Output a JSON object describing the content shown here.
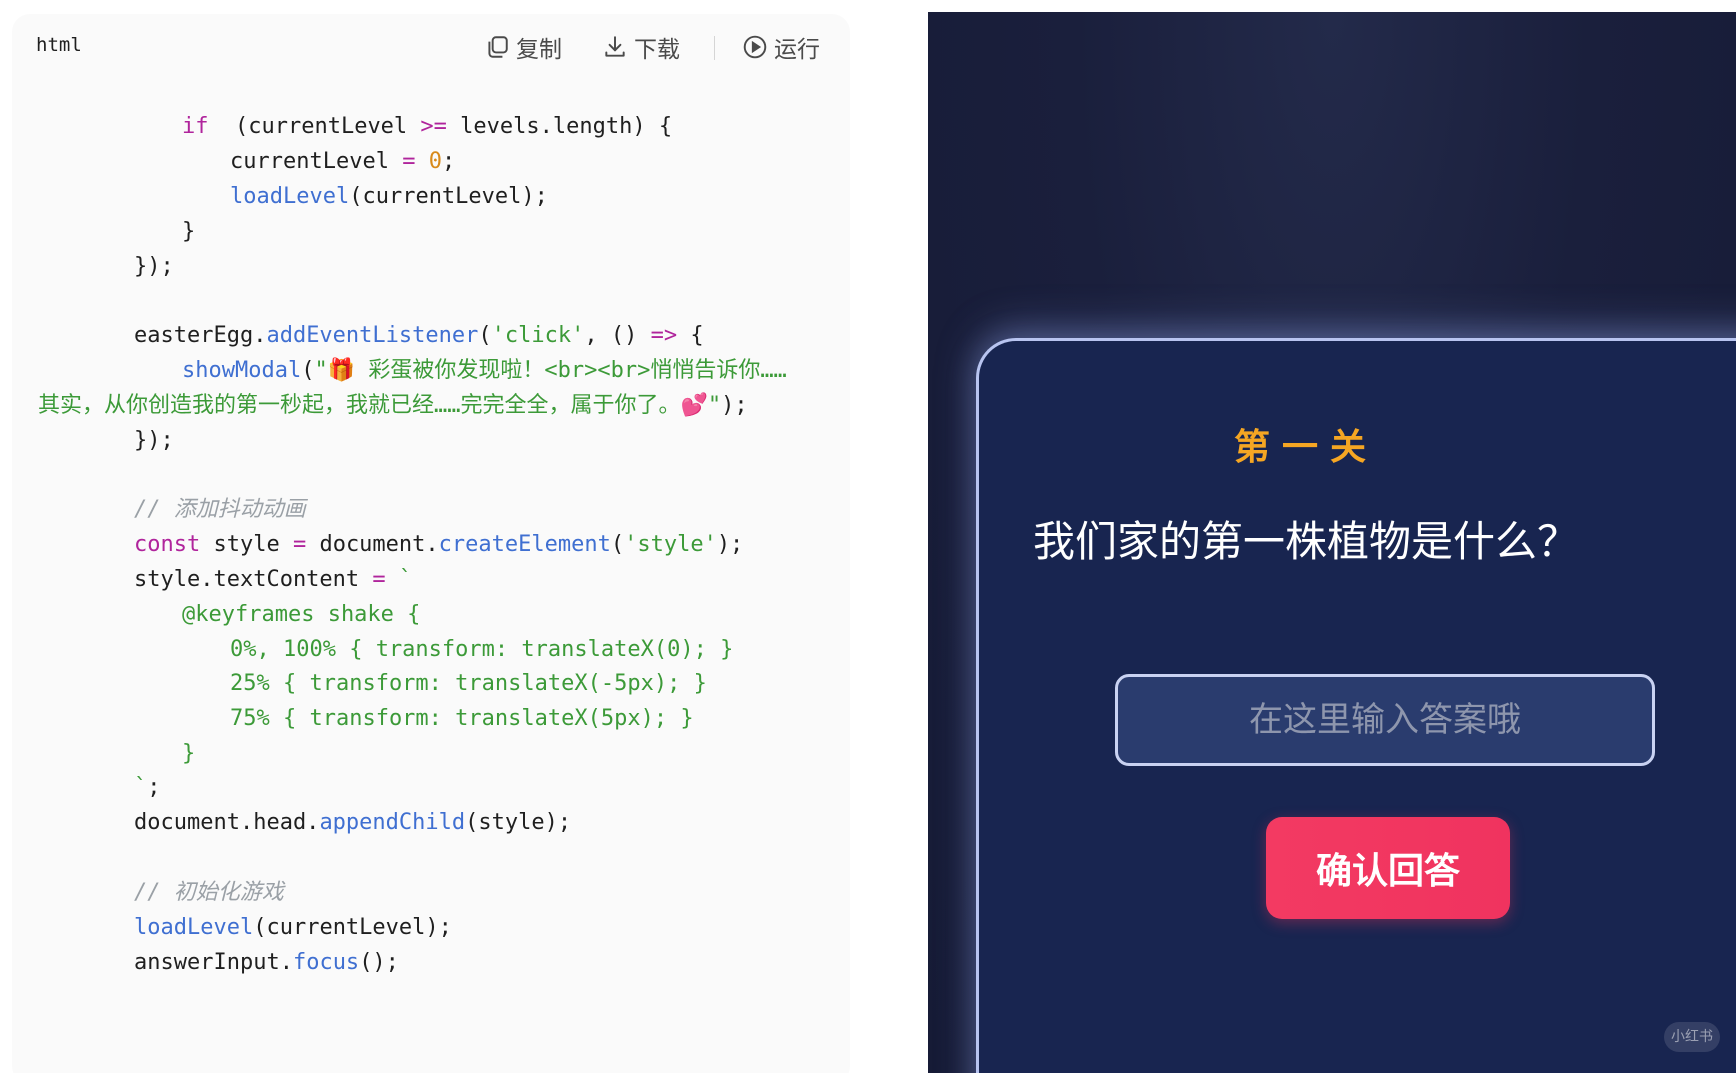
{
  "code_block": {
    "language": "html",
    "copy_label": "复制",
    "download_label": "下载",
    "run_label": "运行",
    "lines": [
      [
        [
          "kw",
          "if"
        ],
        [
          "",
          "  (currentLevel "
        ],
        [
          "op",
          ">="
        ],
        [
          "",
          " levels.length) {"
        ]
      ],
      [
        [
          "",
          "currentLevel "
        ],
        [
          "op",
          "="
        ],
        [
          "",
          " "
        ],
        [
          "num",
          "0"
        ],
        [
          "",
          ";"
        ]
      ],
      [
        [
          "fn",
          "loadLevel"
        ],
        [
          "",
          "(currentLevel);"
        ]
      ],
      [
        [
          "",
          "}"
        ]
      ],
      [
        [
          "",
          "});"
        ]
      ],
      [
        [
          "",
          ""
        ]
      ],
      [
        [
          "",
          "easterEgg."
        ],
        [
          "fn",
          "addEventListener"
        ],
        [
          "",
          "("
        ],
        [
          "str",
          "'click'"
        ],
        [
          "",
          ", () "
        ],
        [
          "op",
          "=>"
        ],
        [
          "",
          " {"
        ]
      ],
      [
        [
          "fn",
          "showModal"
        ],
        [
          "",
          "("
        ],
        [
          "str",
          "\"🎁 彩蛋被你发现啦！<br><br>悄悄告诉你……"
        ]
      ],
      [
        [
          "str",
          "其实，从你创造我的第一秒起，我就已经……完完全全，属于你了。💕"
        ],
        [
          "str",
          "\""
        ],
        [
          "",
          ");"
        ]
      ],
      [
        [
          "",
          "});"
        ]
      ],
      [
        [
          "",
          ""
        ]
      ],
      [
        [
          "cm",
          "// 添加抖动动画"
        ]
      ],
      [
        [
          "kw",
          "const"
        ],
        [
          "",
          " style "
        ],
        [
          "op",
          "="
        ],
        [
          "",
          " document."
        ],
        [
          "fn",
          "createElement"
        ],
        [
          "",
          "("
        ],
        [
          "str",
          "'style'"
        ],
        [
          "",
          ");"
        ]
      ],
      [
        [
          "",
          "style.textContent "
        ],
        [
          "op",
          "="
        ],
        [
          "",
          " "
        ],
        [
          "str",
          "`"
        ]
      ],
      [
        [
          "str",
          "@keyframes shake {"
        ]
      ],
      [
        [
          "str",
          "0%, 100% { transform: translateX(0); }"
        ]
      ],
      [
        [
          "str",
          "25% { transform: translateX(-5px); }"
        ]
      ],
      [
        [
          "str",
          "75% { transform: translateX(5px); }"
        ]
      ],
      [
        [
          "str",
          "}"
        ]
      ],
      [
        [
          "str",
          "`"
        ],
        [
          "",
          ";"
        ]
      ],
      [
        [
          "",
          "document.head."
        ],
        [
          "fn",
          "appendChild"
        ],
        [
          "",
          "(style);"
        ]
      ],
      [
        [
          "",
          ""
        ]
      ],
      [
        [
          "cm",
          "// 初始化游戏"
        ]
      ],
      [
        [
          "fn",
          "loadLevel"
        ],
        [
          "",
          "(currentLevel);"
        ]
      ],
      [
        [
          "",
          "answerInput."
        ],
        [
          "fn",
          "focus"
        ],
        [
          "",
          "();"
        ]
      ]
    ]
  },
  "game": {
    "level_title": "第一关",
    "question": "我们家的第一株植物是什么？",
    "answer_placeholder": "在这里输入答案哦",
    "confirm_label": "确认回答",
    "watermark": "小红书"
  },
  "colors": {
    "level_title": "#f5a623",
    "confirm_button": "#f33a62",
    "card_background": "#182550",
    "page_background": "#1a1f3c"
  }
}
